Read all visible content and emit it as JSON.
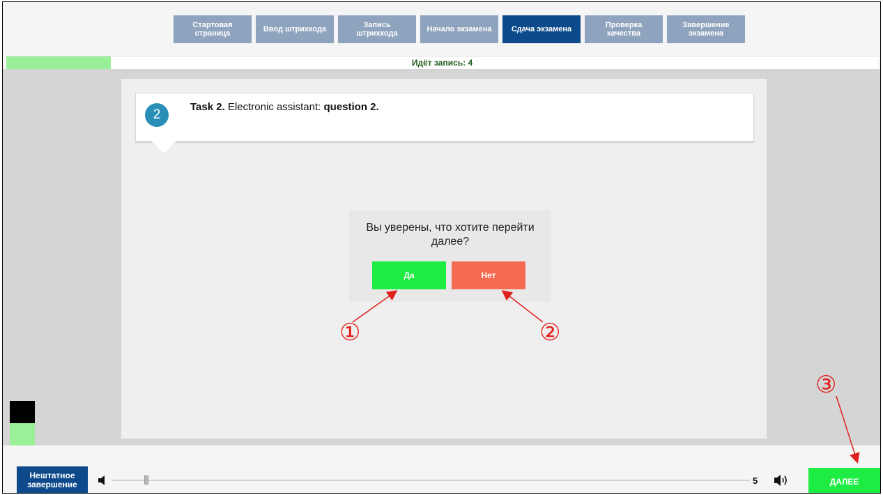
{
  "nav": {
    "steps": [
      {
        "label": "Стартовая страница"
      },
      {
        "label": "Ввод штрихкода"
      },
      {
        "label": "Запись штрихкода"
      },
      {
        "label": "Начало экзамена"
      },
      {
        "label": "Сдача экзамена"
      },
      {
        "label": "Проверка качества"
      },
      {
        "label": "Завершение экзамена"
      }
    ],
    "active_index": 4
  },
  "recording": {
    "label": "Идёт запись: 4",
    "progress": 0.12
  },
  "task": {
    "number": "2",
    "prefix": "Task 2.",
    "text": " Electronic assistant: ",
    "suffix": "question 2."
  },
  "dialog": {
    "question": "Вы уверены, что хотите перейти далее?",
    "yes_label": "Да",
    "no_label": "Нет"
  },
  "footer": {
    "abort_label": "Нештатное завершение",
    "volume_value": "5",
    "volume_fraction": 0.05,
    "next_label": "ДАЛЕЕ"
  },
  "annotations": {
    "marker1": "①",
    "marker2": "②",
    "marker3": "③"
  },
  "colors": {
    "nav_inactive": "#8ea3bd",
    "nav_active": "#0d4a8c",
    "yes": "#1eec43",
    "no": "#f56a53",
    "annotation": "#e0201c"
  },
  "icons": [
    "speaker-low-icon",
    "speaker-high-icon",
    "microphone-icon"
  ]
}
